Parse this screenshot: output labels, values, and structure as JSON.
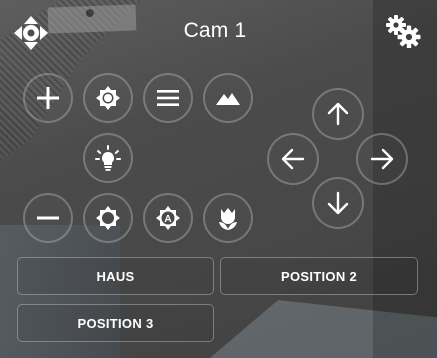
{
  "header": {
    "title": "Cam 1"
  },
  "icons": {
    "move": "move-arrows-icon",
    "settings": "gears-icon",
    "zoom_in": "plus-icon",
    "zoom_out": "minus-icon",
    "brightness_up": "brightness-high-icon",
    "brightness_down": "brightness-low-icon",
    "menu": "hamburger-menu-icon",
    "landscape": "mountains-icon",
    "light": "lightbulb-icon",
    "auto": "auto-brightness-icon",
    "macro": "flower-icon",
    "up": "arrow-up-icon",
    "down": "arrow-down-icon",
    "left": "arrow-left-icon",
    "right": "arrow-right-icon"
  },
  "presets": [
    {
      "label": "HAUS"
    },
    {
      "label": "POSITION 2"
    },
    {
      "label": "POSITION 3"
    }
  ],
  "colors": {
    "icon": "#ffffff",
    "button_border": "#c8c8c8"
  }
}
